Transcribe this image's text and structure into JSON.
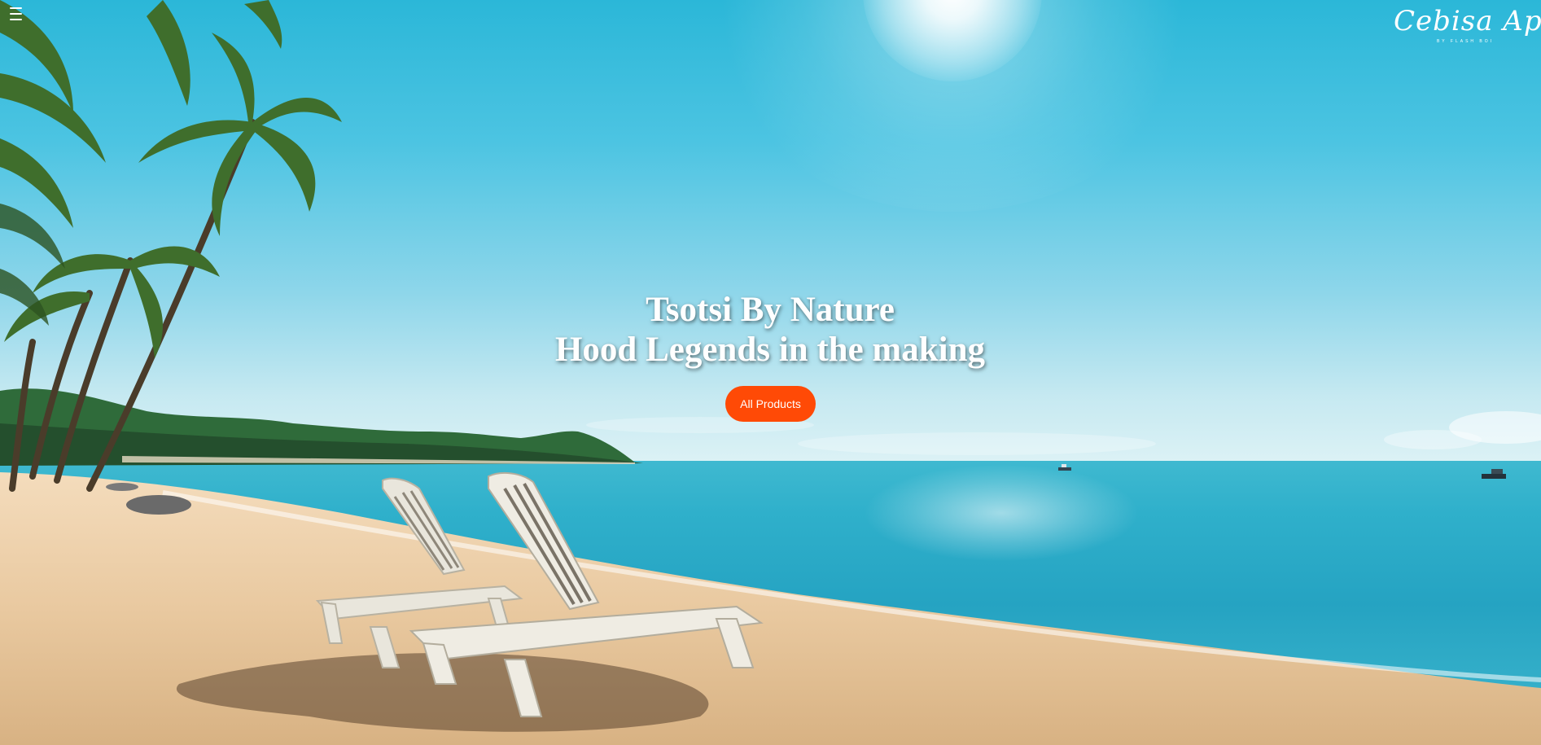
{
  "header": {
    "menu_icon": "hamburger-menu-icon",
    "logo": {
      "name": "Cebisa Apparel",
      "tagline": "BY FLASH BOI"
    }
  },
  "hero": {
    "headline_line1": "Tsotsi By Nature",
    "headline_line2": "Hood Legends in the making",
    "cta_label": "All Products",
    "cta_color": "#ff4a06",
    "background_image": "tropical-beach-with-palm-trees-and-lounge-chairs"
  }
}
